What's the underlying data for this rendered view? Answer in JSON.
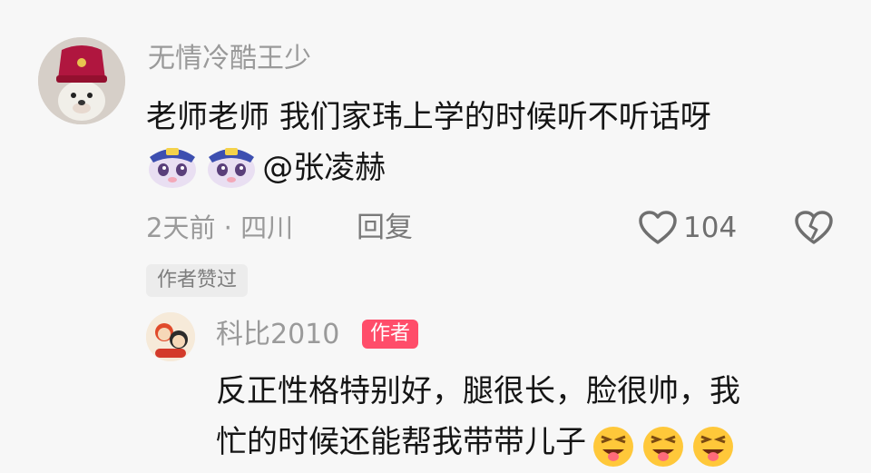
{
  "comment": {
    "username": "无情冷酷王少",
    "text": "老师老师 我们家玮上学的时候听不听话呀",
    "mention": "@张凌赫",
    "meta_time_location": "2天前 · 四川",
    "reply_label": "回复",
    "like_count": "104",
    "author_liked_tag": "作者赞过",
    "icons": [
      "heart-outline-icon",
      "broken-heart-icon"
    ]
  },
  "reply": {
    "username": "科比2010",
    "author_badge": "作者",
    "text_line1": "反正性格特别好，腿很长，脸很帅，我",
    "text_line2": "忙的时候还能帮我带带儿子"
  },
  "colors": {
    "background": "#f7f7f7",
    "author_badge": "#ff4d6a",
    "muted_text": "#9a9a9a"
  }
}
